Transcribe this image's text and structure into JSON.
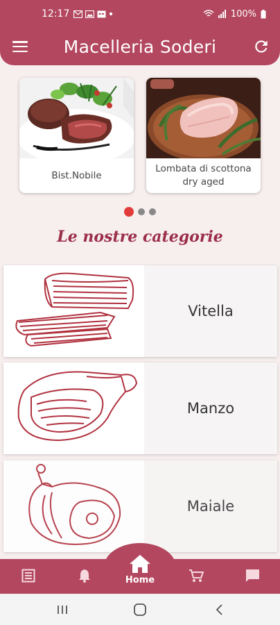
{
  "status_bar": {
    "time": "12:17",
    "battery": "100%",
    "icons": [
      "gmail-icon",
      "photo-icon",
      "calendar-icon",
      "dot-icon",
      "wifi-icon",
      "signal-icon",
      "battery-icon"
    ]
  },
  "app_bar": {
    "title": "Macelleria Soderi",
    "menu_icon": "hamburger-menu-icon",
    "refresh_icon": "refresh-icon"
  },
  "carousel": {
    "items": [
      {
        "label": "Bist.Nobile"
      },
      {
        "label": "Lombata di scottona dry aged"
      }
    ],
    "page_count": 3,
    "active_index": 0
  },
  "section": {
    "title": "Le nostre categorie"
  },
  "categories": [
    {
      "name": "Vitella"
    },
    {
      "name": "Manzo"
    },
    {
      "name": "Maiale"
    }
  ],
  "bottom_nav": {
    "items": [
      {
        "icon": "list-icon"
      },
      {
        "icon": "bell-icon"
      },
      {
        "icon": "home-icon",
        "label": "Home",
        "active": true
      },
      {
        "icon": "cart-icon"
      },
      {
        "icon": "chat-icon"
      }
    ]
  },
  "colors": {
    "brand": "#b3475f",
    "section_title": "#9a2d48",
    "background": "#f7eeee",
    "dot_active": "#e23b3b",
    "illustration": "#b0303e"
  }
}
